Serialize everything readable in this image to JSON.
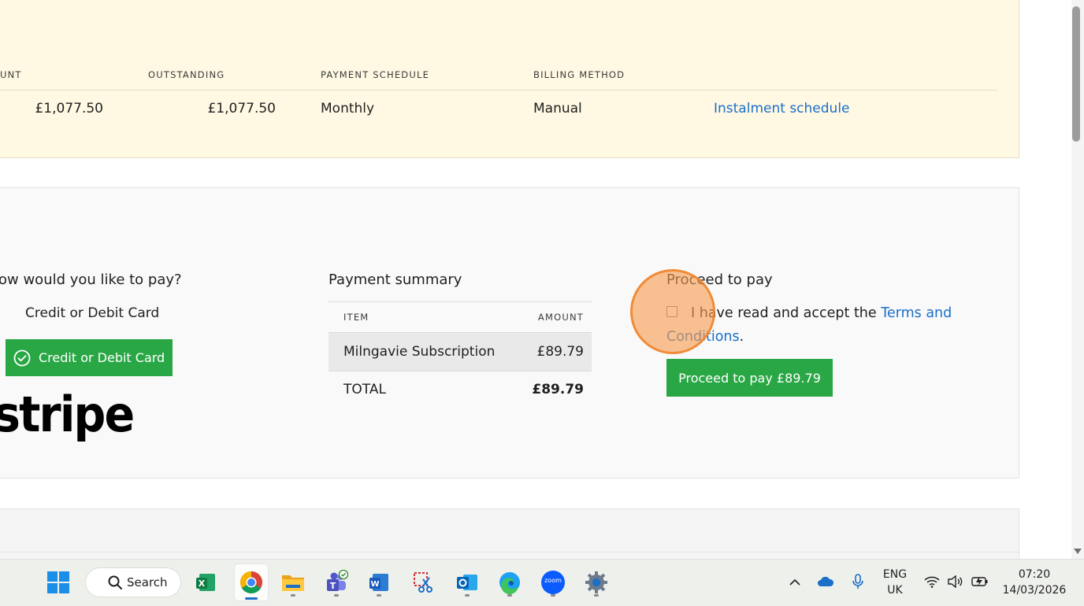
{
  "policy": {
    "columns": {
      "amount_head": "UNT",
      "outstanding_head": "OUTSTANDING",
      "schedule_head": "PAYMENT SCHEDULE",
      "billing_head": "BILLING METHOD"
    },
    "row": {
      "amount": "£1,077.50",
      "outstanding": "£1,077.50",
      "schedule": "Monthly",
      "billing": "Manual",
      "instalment_link": "Instalment schedule"
    }
  },
  "payment": {
    "method_title": "ow would you like to pay?",
    "method_label": "Credit or Debit Card",
    "method_button": "Credit or Debit Card",
    "stripe_logo": "stripe",
    "summary": {
      "title": "Payment summary",
      "item_head": "ITEM",
      "amount_head": "AMOUNT",
      "items": [
        {
          "name": "Milngavie Subscription",
          "amount": "£89.79"
        }
      ],
      "total_label": "TOTAL",
      "total_value": "£89.79"
    },
    "proceed": {
      "title": "Proceed to pay",
      "terms_prefix": "I have read and accept the ",
      "terms_link": "Terms and Conditions",
      "terms_suffix": ".",
      "button": "Proceed to pay £89.79"
    }
  },
  "taskbar": {
    "search_label": "Search",
    "apps": [
      "excel-icon",
      "chrome-icon",
      "file-explorer-icon",
      "teams-icon",
      "word-icon",
      "snipping-tool-icon",
      "outlook-icon",
      "edge-icon",
      "zoom-icon",
      "settings-icon"
    ],
    "zoom_label": "zoom",
    "language": "ENG",
    "region": "UK",
    "time": "07:20",
    "date": "14/03/2026"
  },
  "colors": {
    "accent_green": "#2aa745",
    "link_blue": "#1a6fc9",
    "policy_bg": "#fff8e3",
    "click_marker": "#f79d50"
  }
}
